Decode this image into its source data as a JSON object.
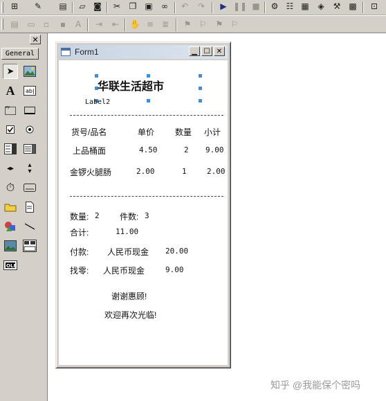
{
  "toolbar": {
    "row1_icons": [
      "add-form-icon",
      "add-module-icon",
      "menu-editor-icon",
      "open-icon",
      "save-icon",
      "cut-icon",
      "copy-icon",
      "paste-icon",
      "find-icon",
      "undo-icon",
      "redo-icon",
      "run-icon",
      "pause-icon",
      "stop-icon",
      "project-explorer-icon",
      "properties-icon",
      "form-layout-icon",
      "object-browser-icon",
      "toolbox-icon",
      "data-view-icon"
    ],
    "row2_icons": [
      "indent-icon",
      "outdent-icon",
      "toggle-breakpoint-icon",
      "comment-block-icon",
      "uncomment-block-icon",
      "toggle-bookmark-icon",
      "next-bookmark-icon",
      "previous-bookmark-icon",
      "clear-bookmarks-icon"
    ]
  },
  "toolbox": {
    "close_label": "✕",
    "tab_label": "General",
    "tools": [
      "pointer-icon",
      "picturebox-icon",
      "label-tool-icon",
      "textbox-tool-icon",
      "frame-tool-icon",
      "commandbutton-tool-icon",
      "checkbox-tool-icon",
      "optionbutton-tool-icon",
      "combobox-tool-icon",
      "listbox-tool-icon",
      "hscrollbar-tool-icon",
      "vscrollbar-tool-icon",
      "timer-tool-icon",
      "drivelistbox-tool-icon",
      "dirlistbox-tool-icon",
      "filelistbox-tool-icon",
      "shape-tool-icon",
      "line-tool-icon",
      "image-tool-icon",
      "data-tool-icon",
      "ole-tool-icon"
    ]
  },
  "form": {
    "title": "Form1",
    "store_name": "华联生活超市",
    "label2": "Label2",
    "headers": [
      "货号/品名",
      "单价",
      "数量",
      "小计"
    ],
    "items": [
      {
        "name": "上品桶面",
        "price": "4.50",
        "qty": "2",
        "subtotal": "9.00"
      },
      {
        "name": "金锣火腿肠",
        "price": "2.00",
        "qty": "1",
        "subtotal": "2.00"
      }
    ],
    "count_label": "数量:",
    "count_value": "2",
    "pieces_label": "件数:",
    "pieces_value": "3",
    "total_label": "合计:",
    "total_value": "11.00",
    "pay_label": "付款:",
    "pay_method": "人民币现金",
    "pay_value": "20.00",
    "change_label": "找零:",
    "change_method": "人民币现金",
    "change_value": "9.00",
    "thanks": "谢谢惠顾!",
    "welcome": "欢迎再次光临!"
  },
  "watermark": "知乎 @我能保个密吗"
}
